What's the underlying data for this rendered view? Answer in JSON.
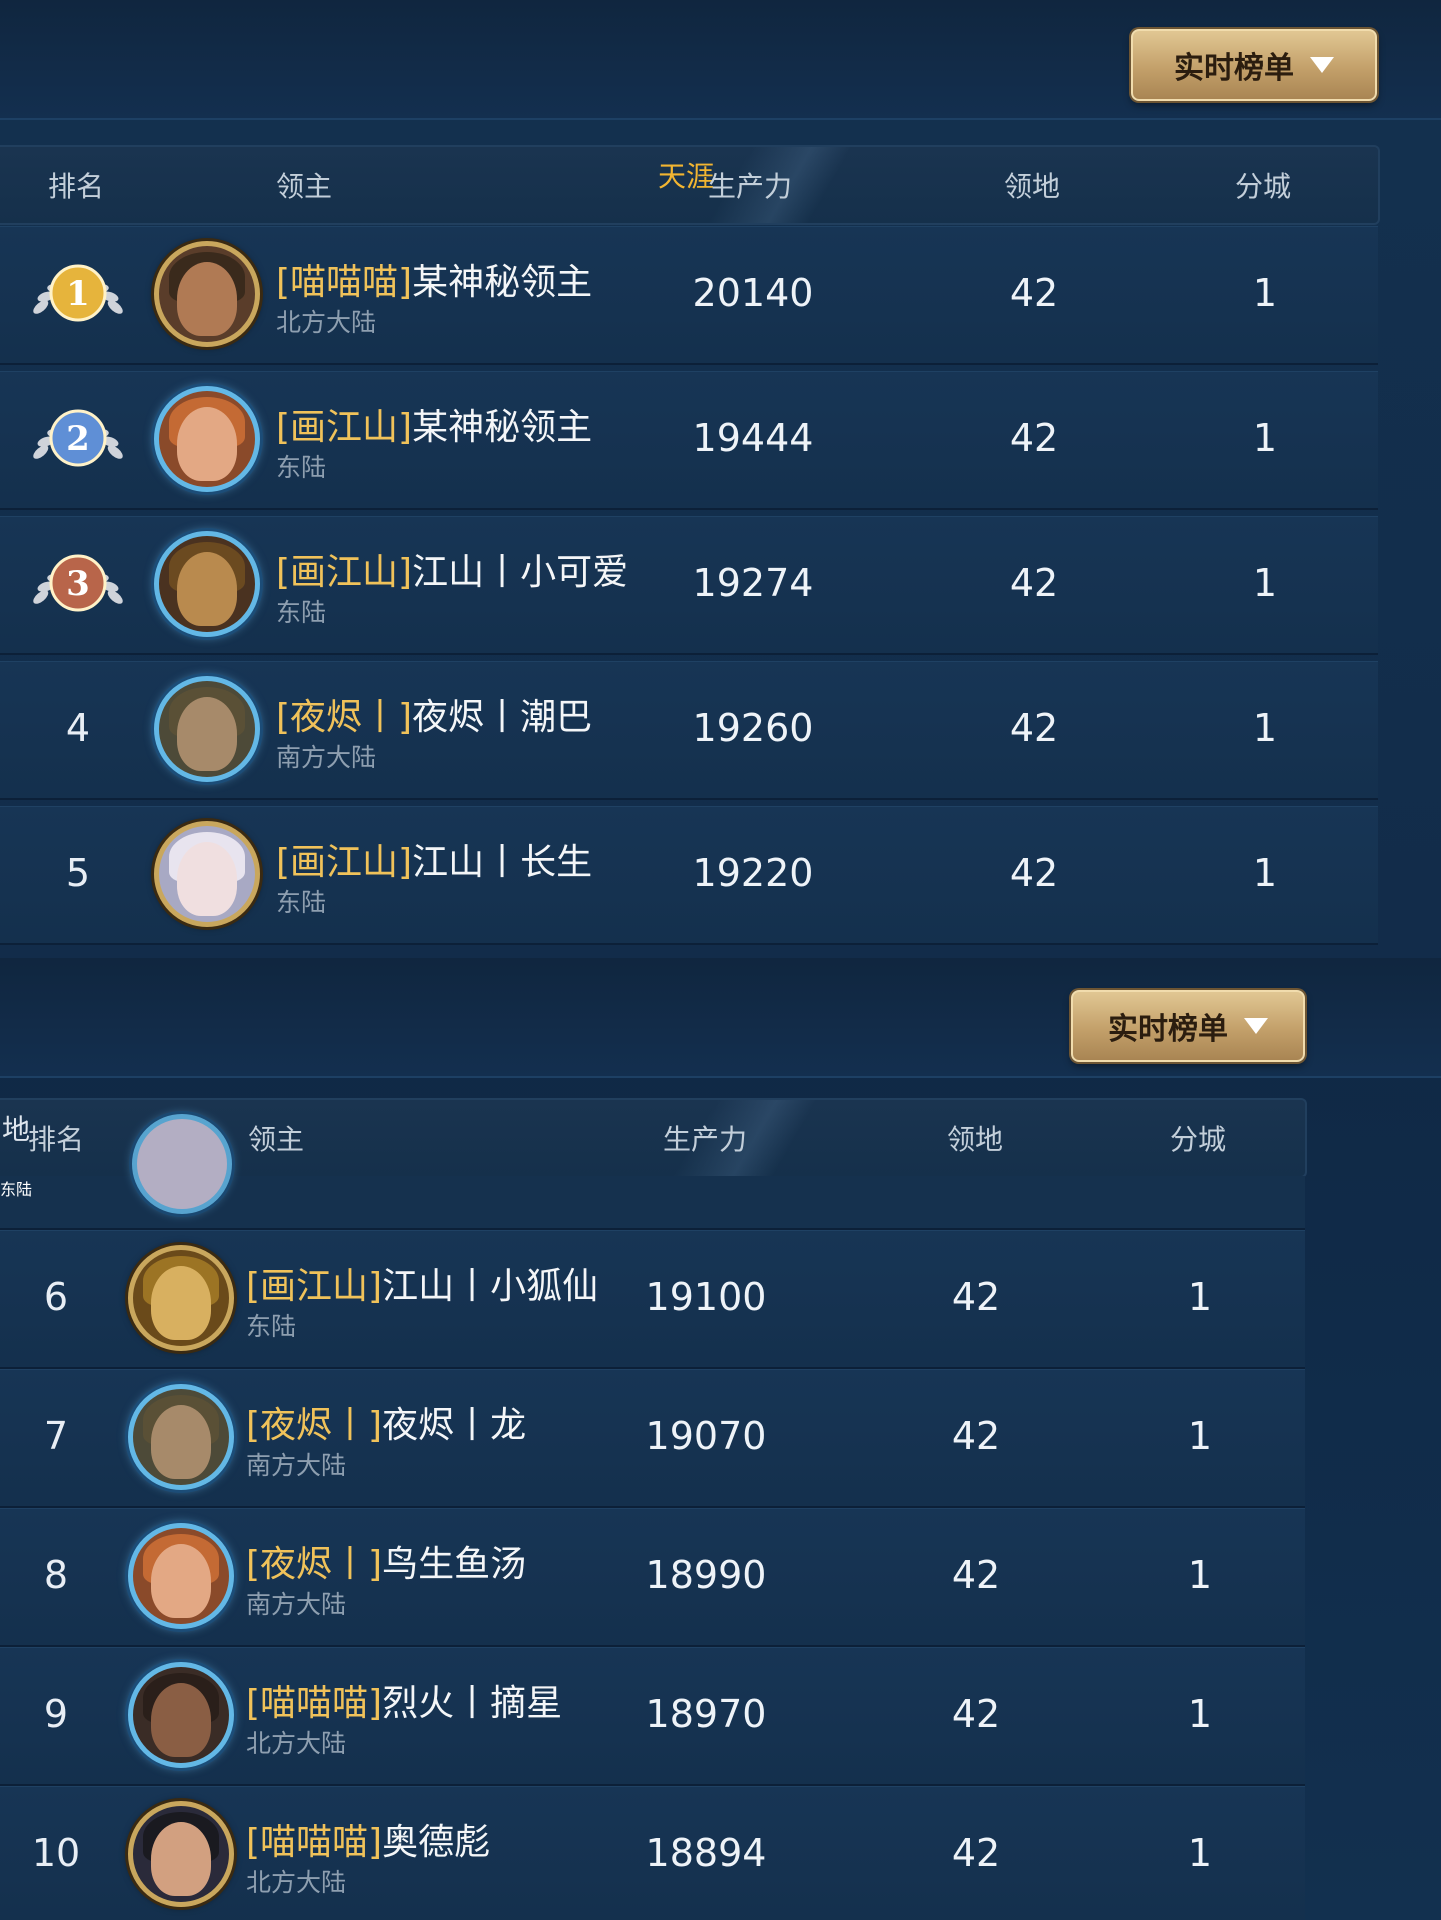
{
  "top_panel": {
    "dropdown_label": "实时榜单",
    "headers": {
      "rank": "排名",
      "lord": "领主",
      "overlay": "天涯",
      "production": "生产力",
      "territory": "领地",
      "branch": "分城"
    },
    "rows": [
      {
        "rank": "1",
        "tag": "[喵喵喵]",
        "name": "某神秘领主",
        "region": "北方大陆",
        "production": "20140",
        "territory": "42",
        "branch": "1"
      },
      {
        "rank": "2",
        "tag": "[画江山]",
        "name": "某神秘领主",
        "region": "东陆",
        "production": "19444",
        "territory": "42",
        "branch": "1"
      },
      {
        "rank": "3",
        "tag": "[画江山]",
        "name": "江山丨小可爱",
        "region": "东陆",
        "production": "19274",
        "territory": "42",
        "branch": "1"
      },
      {
        "rank": "4",
        "tag": "[夜烬丨]",
        "name": "夜烬丨潮巴",
        "region": "南方大陆",
        "production": "19260",
        "territory": "42",
        "branch": "1"
      },
      {
        "rank": "5",
        "tag": "[画江山]",
        "name": "江山丨长生",
        "region": "东陆",
        "production": "19220",
        "territory": "42",
        "branch": "1"
      }
    ]
  },
  "bottom_panel": {
    "dropdown_label": "实时榜单",
    "headers": {
      "overlay": "地",
      "rank": "排名",
      "lord": "领主",
      "production": "生产力",
      "territory": "领地",
      "branch": "分城"
    },
    "partial_region": "东陆",
    "rows": [
      {
        "rank": "6",
        "tag": "[画江山]",
        "name": "江山丨小狐仙",
        "region": "东陆",
        "production": "19100",
        "territory": "42",
        "branch": "1"
      },
      {
        "rank": "7",
        "tag": "[夜烬丨]",
        "name": "夜烬丨龙",
        "region": "南方大陆",
        "production": "19070",
        "territory": "42",
        "branch": "1"
      },
      {
        "rank": "8",
        "tag": "[夜烬丨]",
        "name": "鸟生鱼汤",
        "region": "南方大陆",
        "production": "18990",
        "territory": "42",
        "branch": "1"
      },
      {
        "rank": "9",
        "tag": "[喵喵喵]",
        "name": "烈火丨摘星",
        "region": "北方大陆",
        "production": "18970",
        "territory": "42",
        "branch": "1"
      },
      {
        "rank": "10",
        "tag": "[喵喵喵]",
        "name": "奥德彪",
        "region": "北方大陆",
        "production": "18894",
        "territory": "42",
        "branch": "1"
      }
    ]
  },
  "colors": {
    "accent_gold": "#f0c25a",
    "dropdown": "#c3a06a",
    "row_bg": "#173555",
    "tianya": "#f2b531"
  },
  "medal_colors": [
    "#e6b43c",
    "#5f8fd6",
    "#b8654a"
  ]
}
